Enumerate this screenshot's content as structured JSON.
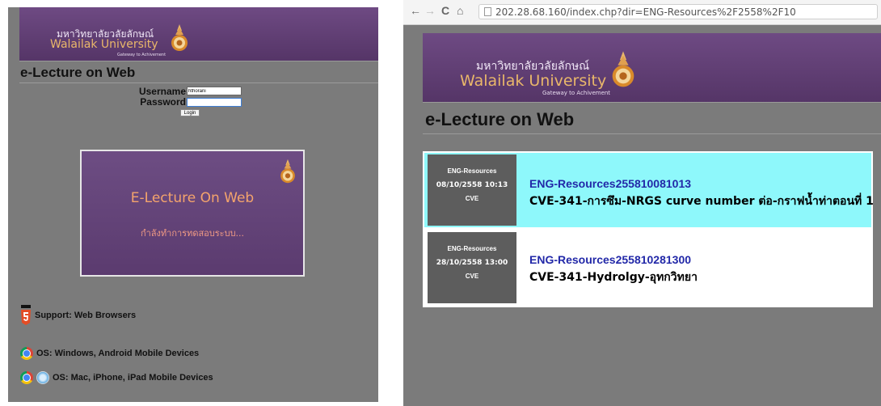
{
  "left": {
    "banner": {
      "thai_name": "มหาวิทยาลัยวลัยลักษณ์",
      "english_name": "Walailak University",
      "slogan": "Gateway to Achivement"
    },
    "site_title": "e-Lecture on Web",
    "login": {
      "username_label": "Username",
      "username_value": "hthorani",
      "password_label": "Password",
      "password_value": "",
      "login_button": "Login"
    },
    "splash": {
      "title": "E-Lecture On Web",
      "subtitle": "กำลังทำการทดสอบระบบ..."
    },
    "support": [
      {
        "icon": "html5-icon",
        "text": "Support: Web Browsers"
      },
      {
        "icon": "chrome-icon",
        "text": "OS: Windows, Android Mobile Devices"
      },
      {
        "icon": "chrome-safari-icon",
        "text": "OS: Mac, iPhone, iPad Mobile Devices"
      }
    ]
  },
  "right": {
    "browser": {
      "url": "202.28.68.160/index.chp?dir=ENG-Resources%2F2558%2F10"
    },
    "banner": {
      "thai_name": "มหาวิทยาลัยวลัยลักษณ์",
      "english_name": "Walailak University",
      "slogan": "Gateway to Achivement"
    },
    "site_title": "e-Lecture on Web",
    "entries": [
      {
        "category": "ENG-Resources",
        "date": "08/10/2558 10:13",
        "dept": "CVE",
        "link": "ENG-Resources255810081013",
        "description": "CVE-341-การซึม-NRGS curve number ต่อ-กราฟน้ำท่าตอนที่ 1"
      },
      {
        "category": "ENG-Resources",
        "date": "28/10/2558 13:00",
        "dept": "CVE",
        "link": "ENG-Resources255810281300",
        "description": "CVE-341-Hydrolgy-อุทกวิทยา"
      }
    ]
  },
  "colors": {
    "page_gray": "#7b7b7b",
    "banner_purple": "#603d73",
    "highlight_cyan": "#8ef8fb",
    "link_blue": "#2228a8",
    "accent_orange": "#e9b76a"
  }
}
